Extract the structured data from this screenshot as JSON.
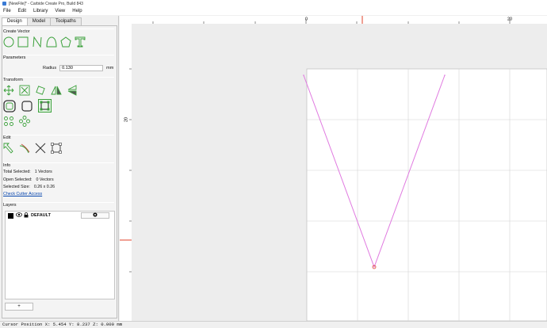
{
  "window": {
    "title": "[NewFile]* - Carbide Create Pro, Build 843"
  },
  "menu": [
    {
      "label": "File"
    },
    {
      "label": "Edit"
    },
    {
      "label": "Library"
    },
    {
      "label": "View"
    },
    {
      "label": "Help"
    }
  ],
  "tabs": [
    {
      "label": "Design",
      "active": true
    },
    {
      "label": "Model",
      "active": false
    },
    {
      "label": "Toolpaths",
      "active": false
    }
  ],
  "sections": {
    "create_vector": "Create Vector",
    "parameters": "Parameters",
    "transform": "Transform",
    "edit": "Edit",
    "info": "Info",
    "layers": "Layers"
  },
  "parameters": {
    "radius_label": "Radius",
    "radius_value": "0.130",
    "radius_unit": "mm"
  },
  "info": {
    "total_selected_label": "Total Selected:",
    "total_selected_value": "1 Vectors",
    "open_selected_label": "Open Selected:",
    "open_selected_value": "0 Vectors",
    "selected_size_label": "Selected Size:",
    "selected_size_value": "0.26 x 0.26",
    "check_cutter_link": "Check Cutter Access"
  },
  "layers": {
    "items": [
      {
        "name": "DEFAULT",
        "color": "#000000"
      }
    ],
    "add_label": "+"
  },
  "ruler": {
    "top_labels": [
      "0",
      "20"
    ],
    "left_labels": [
      "20"
    ]
  },
  "colors": {
    "vector": "#e07ae0",
    "marker": "#e0402a",
    "icon_green": "#3aa03a",
    "grid": "#d4d4d4"
  },
  "status": {
    "cursor": "Cursor Position X: 5.454 Y: 8.237 Z: 0.000 mm"
  }
}
